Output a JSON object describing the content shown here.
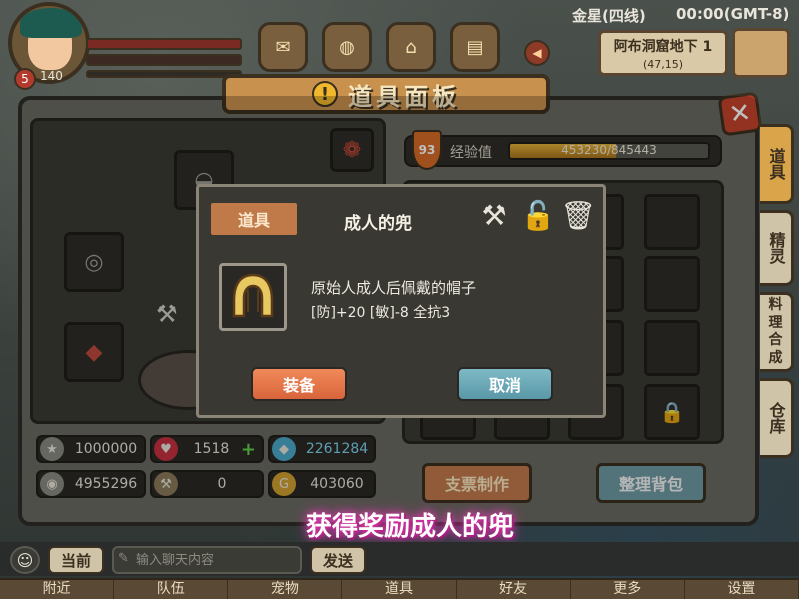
{
  "hud": {
    "player_level": "5",
    "player_level_number": "140",
    "server": "金星(四线)",
    "time": "00:00(GMT-8)",
    "map_name": "阿布洞窟地下 1",
    "map_coords": "(47,15)"
  },
  "panel": {
    "title": "道具面板"
  },
  "stats": {
    "fame": "1000000",
    "hp": "1518",
    "diamond": "2261284",
    "silver": "4955296",
    "tool": "0",
    "gold": "403060"
  },
  "inventory": {
    "level": "93",
    "exp_label": "经验值",
    "exp_text": "453230/845443",
    "exp_fraction": 0.536,
    "cheque_button": "支票制作",
    "sort_button": "整理背包"
  },
  "side_tabs": [
    "道具",
    "精灵",
    "料理合成",
    "仓库"
  ],
  "popup": {
    "tag": "道具",
    "item_name": "成人的兜",
    "description": "原始人成人后佩戴的帽子",
    "stats_line": "[防]+20  [敏]-8  全抗3",
    "equip_button": "装备",
    "cancel_button": "取消"
  },
  "toast": "获得奖励成人的兜",
  "chat": {
    "channel": "当前",
    "placeholder": "输入聊天内容",
    "send": "发送"
  },
  "bottom_nav": [
    "附近",
    "队伍",
    "宠物",
    "道具",
    "好友",
    "更多",
    "设置"
  ],
  "colors": {
    "accent_orange": "#d9643c",
    "accent_blue": "#5a98a8",
    "toast_glow": "#e23ab0"
  }
}
